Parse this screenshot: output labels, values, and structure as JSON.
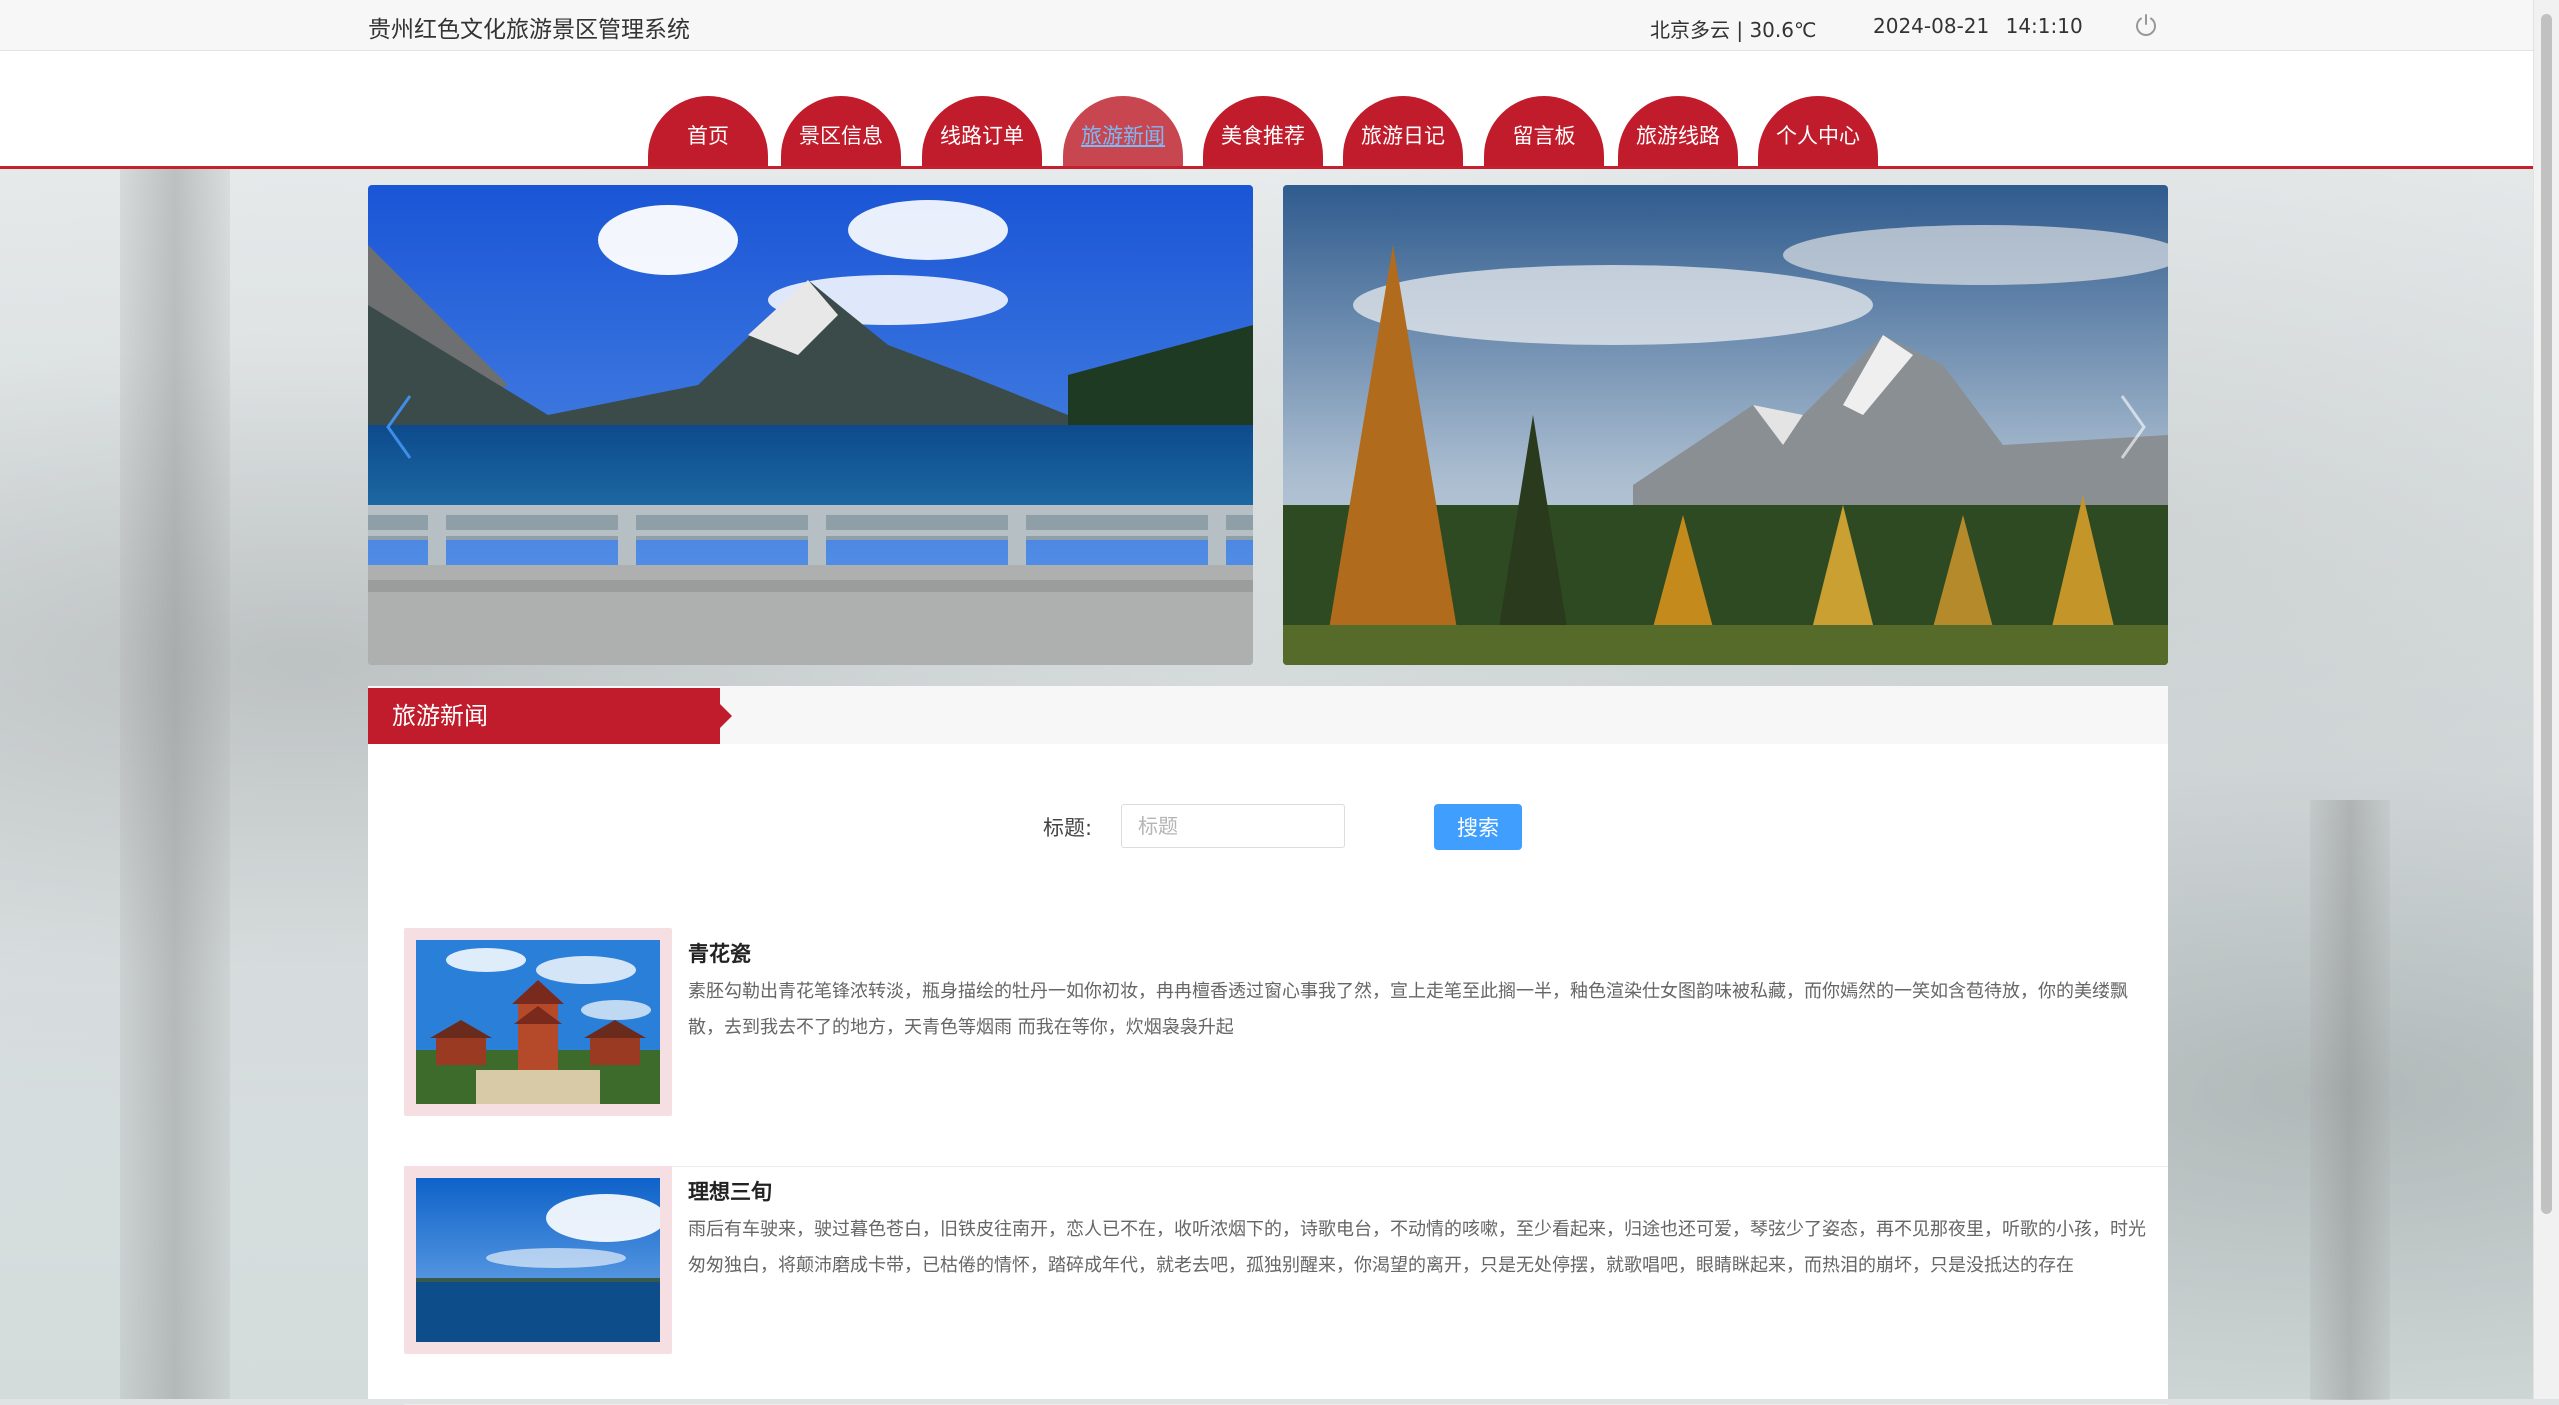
{
  "header": {
    "system_title": "贵州红色文化旅游景区管理系统",
    "weather": "北京多云 | 30.6℃",
    "date": "2024-08-21",
    "time": "14:1:10",
    "logout_icon": "power-icon"
  },
  "nav": {
    "items": [
      {
        "label": "首页"
      },
      {
        "label": "景区信息"
      },
      {
        "label": "线路订单"
      },
      {
        "label": "旅游新闻",
        "active": true
      },
      {
        "label": "美食推荐"
      },
      {
        "label": "旅游日记"
      },
      {
        "label": "留言板"
      },
      {
        "label": "旅游线路"
      },
      {
        "label": "个人中心"
      }
    ]
  },
  "carousel": {
    "prev_icon": "chevron-left-icon",
    "next_icon": "chevron-right-icon"
  },
  "news": {
    "section_title": "旅游新闻",
    "search": {
      "label": "标题:",
      "placeholder": "标题",
      "value": "",
      "button_label": "搜索"
    },
    "items": [
      {
        "title": "青花瓷",
        "description": "素胚勾勒出青花笔锋浓转淡，瓶身描绘的牡丹一如你初妆，冉冉檀香透过窗心事我了然，宣上走笔至此搁一半，釉色渲染仕女图韵味被私藏，而你嫣然的一笑如含苞待放，你的美缕飘散，去到我去不了的地方，天青色等烟雨 而我在等你，炊烟袅袅升起"
      },
      {
        "title": "理想三旬",
        "description": "雨后有车驶来，驶过暮色苍白，旧铁皮往南开，恋人已不在，收听浓烟下的，诗歌电台，不动情的咳嗽，至少看起来，归途也还可爱，琴弦少了姿态，再不见那夜里，听歌的小孩，时光匆匆独白，将颠沛磨成卡带，已枯倦的情怀，踏碎成年代，就老去吧，孤独别醒来，你渴望的离开，只是无处停摆，就歌唱吧，眼睛眯起来，而热泪的崩坏，只是没抵达的存在"
      }
    ]
  },
  "colors": {
    "brand_red": "#c01c2c",
    "search_button_blue": "#409eff",
    "active_nav_text": "#7fb8f5"
  }
}
